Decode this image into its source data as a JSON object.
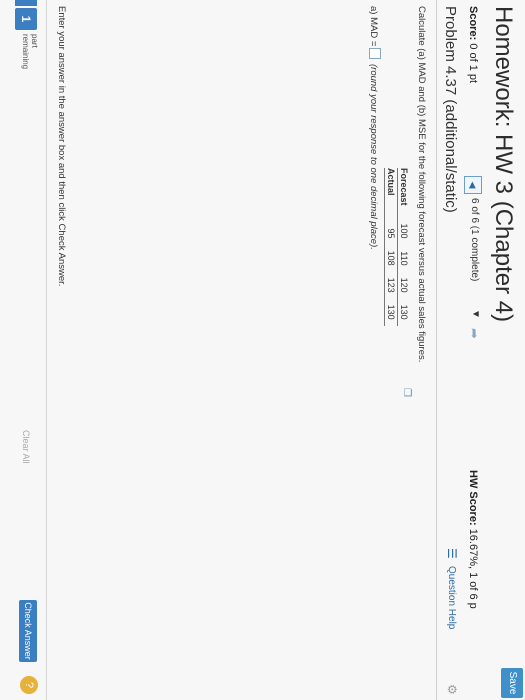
{
  "header": {
    "title": "Homework: HW 3 (Chapter 4)",
    "save_label": "Save",
    "score_prefix": "Score:",
    "score_value": "0 of 1 pt",
    "nav_text": "6 of 6 (1 complete)",
    "hw_score_prefix": "HW Score:",
    "hw_score_value": "16.67%, 1 of 6 p"
  },
  "problem": {
    "title": "Problem 4.37 (additional/static)",
    "question_help": "Question Help",
    "instructions": "Calculate (a) MAD and (b) MSE for the following forecast versus actual sales figures.",
    "table": {
      "rows": [
        {
          "label": "Forecast",
          "values": [
            "100",
            "110",
            "120",
            "130"
          ]
        },
        {
          "label": "Actual",
          "values": [
            "95",
            "108",
            "123",
            "130"
          ]
        }
      ]
    },
    "mad_label": "a) MAD =",
    "mad_note": "(round your response to one decimal place).",
    "mad_value": ""
  },
  "footer": {
    "instructions": "Enter your answer in the answer box and then click Check Answer.",
    "part_number": "1",
    "part_label_line1": "part",
    "part_label_line2": "remaining",
    "clear_all": "Clear All",
    "check_answer": "Check Answer",
    "help_symbol": "?"
  },
  "colors": {
    "accent": "#3b7ec2",
    "help": "#e7b23a"
  },
  "icons": {
    "prev": "triangle-left-icon",
    "caret": "triangle-down-icon",
    "next": "next-arrow-icon",
    "question_help": "list-icon",
    "copy": "copy-icon",
    "settings": "gear-icon"
  }
}
